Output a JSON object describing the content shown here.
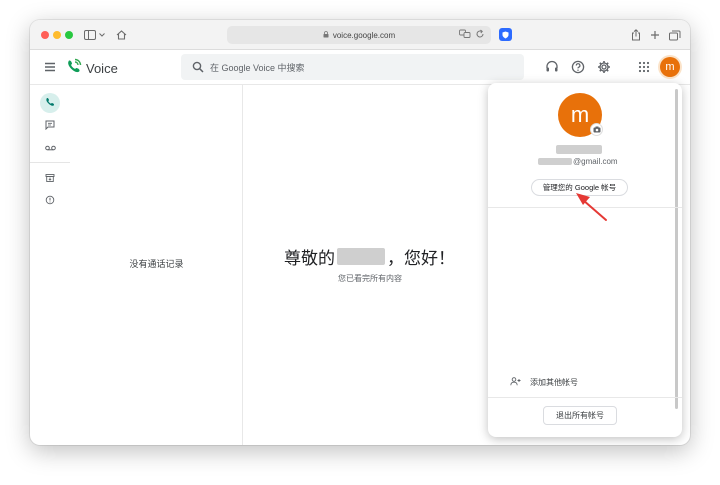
{
  "browser": {
    "url": "voice.google.com"
  },
  "app": {
    "name": "Voice",
    "search_placeholder": "在 Google Voice 中搜索",
    "avatar_letter": "m",
    "accent_color": "#e8710a",
    "brand_green": "#0f9d58"
  },
  "rail": {
    "items": [
      {
        "name": "calls",
        "icon": "phone-icon",
        "active": true
      },
      {
        "name": "messages",
        "icon": "message-icon",
        "active": false
      },
      {
        "name": "voicemail",
        "icon": "voicemail-icon",
        "active": false
      },
      {
        "name": "archive",
        "icon": "archive-icon",
        "active": false
      },
      {
        "name": "spam",
        "icon": "spam-icon",
        "active": false
      }
    ]
  },
  "list": {
    "empty_text": "没有通话记录"
  },
  "main": {
    "greeting_prefix": "尊敬的",
    "greeting_suffix": "，您好！",
    "subtext": "您已看完所有内容"
  },
  "account_popup": {
    "avatar_letter": "m",
    "email_suffix": "@gmail.com",
    "manage_button": "管理您的 Google 帐号",
    "add_account": "添加其他帐号",
    "sign_out": "退出所有帐号"
  }
}
